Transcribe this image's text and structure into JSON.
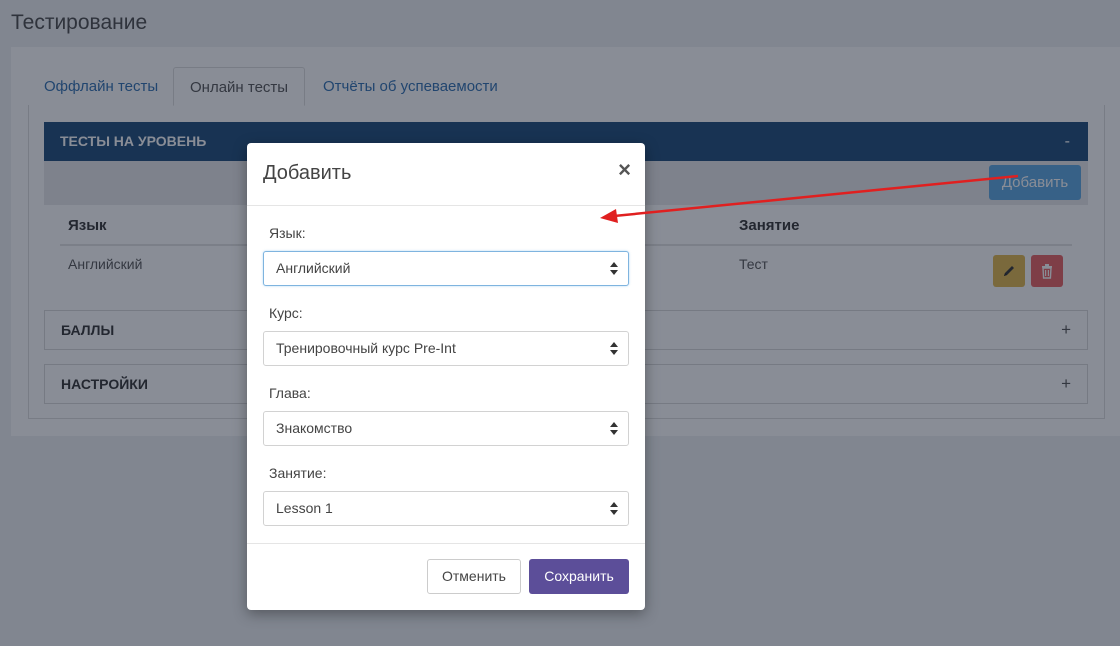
{
  "page": {
    "title": "Тестирование"
  },
  "tabs": [
    {
      "label": "Оффлайн тесты",
      "active": false
    },
    {
      "label": "Онлайн тесты",
      "active": true
    },
    {
      "label": "Отчёты об успеваемости",
      "active": false
    }
  ],
  "levels_panel": {
    "title": "ТЕСТЫ НА УРОВЕНЬ",
    "toggle": "-",
    "add_button": "Добавить",
    "columns": [
      "Язык",
      "Занятие"
    ],
    "rows": [
      {
        "language": "Английский",
        "lesson": "Тест"
      }
    ]
  },
  "scores_panel": {
    "title": "БАЛЛЫ",
    "toggle": "+"
  },
  "settings_panel": {
    "title": "НАСТРОЙКИ",
    "toggle": "+"
  },
  "modal": {
    "title": "Добавить",
    "close": "×",
    "fields": [
      {
        "label": "Язык:",
        "value": "Английский"
      },
      {
        "label": "Курс:",
        "value": "Тренировочный курс Pre-Int"
      },
      {
        "label": "Глава:",
        "value": "Знакомство"
      },
      {
        "label": "Занятие:",
        "value": "Lesson 1"
      }
    ],
    "cancel_label": "Отменить",
    "save_label": "Сохранить"
  },
  "colors": {
    "panel_header": "#1c4a79",
    "add_button": "#5aa6e0",
    "edit_button": "#e1b64a",
    "delete_button": "#e96060",
    "save_button": "#5c4e99",
    "annotation_arrow": "#e02020"
  },
  "icons": {
    "edit": "pencil-icon",
    "delete": "trash-icon",
    "close": "close-icon",
    "select": "sort-arrows-icon"
  }
}
